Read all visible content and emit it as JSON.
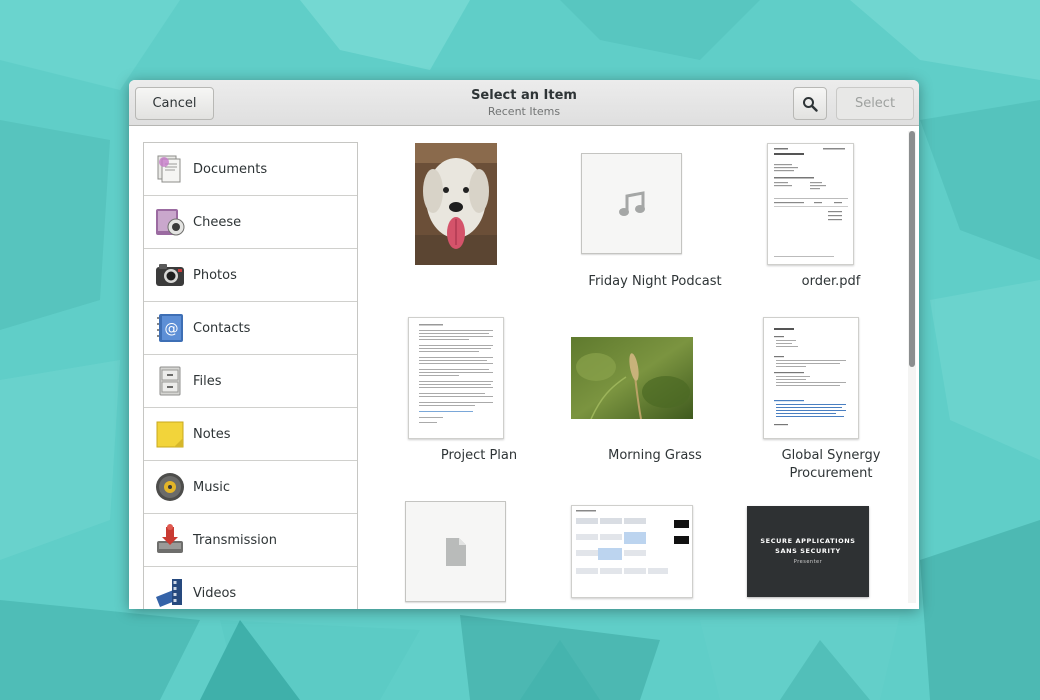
{
  "dialog": {
    "title": "Select an Item",
    "subtitle": "Recent Items",
    "cancel_label": "Cancel",
    "select_label": "Select"
  },
  "sidebar": {
    "items": [
      {
        "label": "Documents",
        "icon": "documents-icon"
      },
      {
        "label": "Cheese",
        "icon": "cheese-icon"
      },
      {
        "label": "Photos",
        "icon": "photos-icon"
      },
      {
        "label": "Contacts",
        "icon": "contacts-icon"
      },
      {
        "label": "Files",
        "icon": "files-icon"
      },
      {
        "label": "Notes",
        "icon": "notes-icon"
      },
      {
        "label": "Music",
        "icon": "music-icon"
      },
      {
        "label": "Transmission",
        "icon": "transmission-icon"
      },
      {
        "label": "Videos",
        "icon": "videos-icon"
      }
    ]
  },
  "items": [
    {
      "caption": "",
      "kind": "photo-dog"
    },
    {
      "caption": "Friday Night Podcast",
      "kind": "audio"
    },
    {
      "caption": "order.pdf",
      "kind": "pdf"
    },
    {
      "caption": "Project Plan",
      "kind": "document"
    },
    {
      "caption": "Morning Grass",
      "kind": "photo-grass"
    },
    {
      "caption": "Global Synergy Procurement",
      "kind": "document"
    },
    {
      "caption": "",
      "kind": "generic-file"
    },
    {
      "caption": "",
      "kind": "spreadsheet"
    },
    {
      "caption": "",
      "kind": "presentation"
    }
  ],
  "slide": {
    "line1": "SECURE APPLICATIONS",
    "line2": "SANS SECURITY",
    "line3": "Presenter"
  },
  "colors": {
    "wallpaper": "#5fcfc9",
    "headerbar": "#e4e4e3",
    "text": "#2e3436"
  }
}
